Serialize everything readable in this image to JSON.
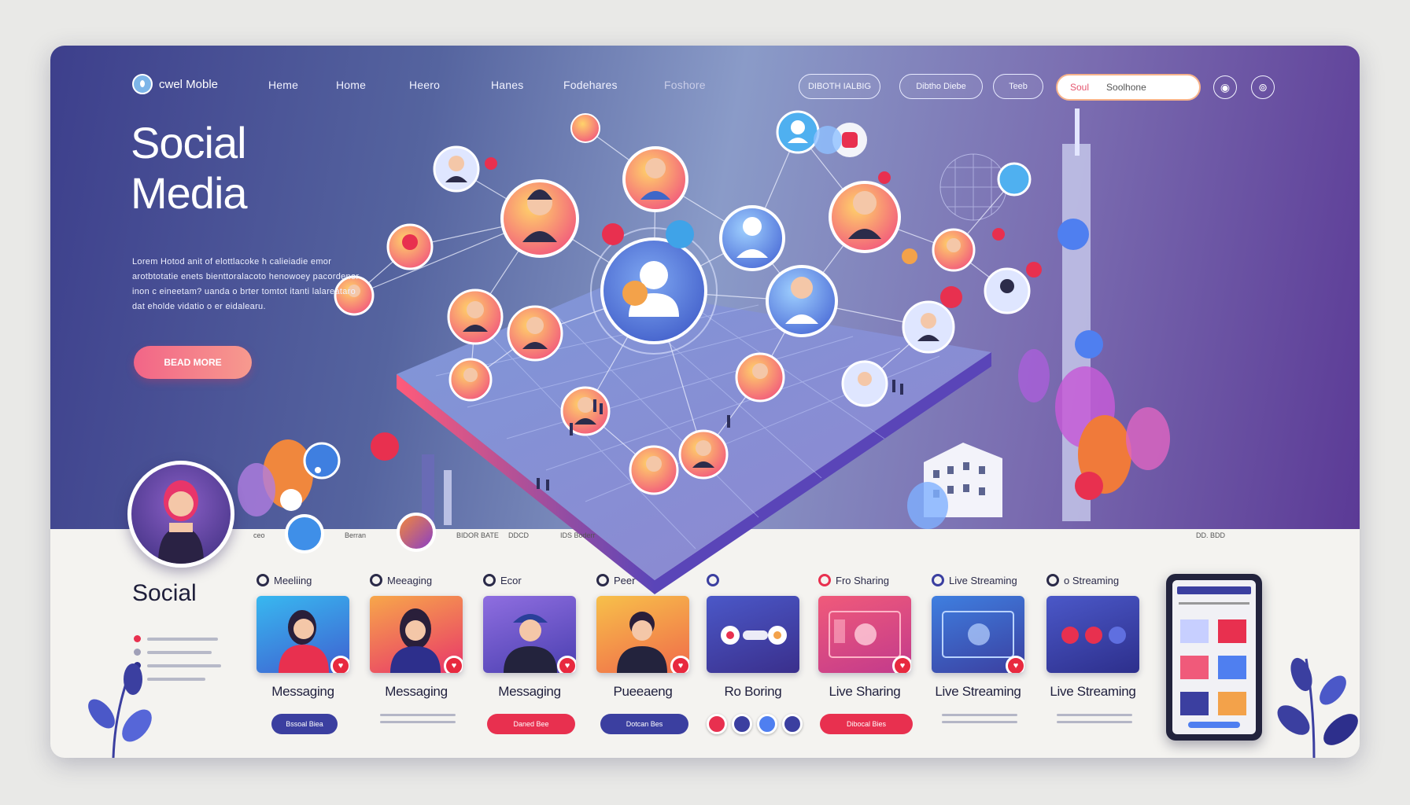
{
  "nav": {
    "logo_text": "cwel Moble",
    "links": [
      "Heme",
      "Home",
      "Heero",
      "Hanes",
      "Fodehares",
      "Foshore"
    ],
    "buttons": [
      "DIBOTH IALBIG",
      "Dibtho Diebe",
      "Teeb"
    ],
    "search": {
      "label": "Soul",
      "placeholder": "Soolhone"
    }
  },
  "hero": {
    "title_line1": "Social",
    "title_line2": "Media",
    "description": "Lorem Hotod anit of elottlacoke h calieiadie emor arotbtotatie enets bienttoralacoto henowoey pacordenor inon c eineetam? uanda o brter tomtot itanti lalareataro dat eholde vidatio o er eidalearu.",
    "cta": "BEAD MORE"
  },
  "subrow": [
    "ceo",
    "Berran",
    "BIDOR BATE",
    "DDCD",
    "IDS Boderr",
    "DD. BDD"
  ],
  "sidebar": {
    "title": "Social",
    "items": [
      {
        "color": "#e8304f",
        "width": 90
      },
      {
        "color": "#a0a0b8",
        "width": 82
      },
      {
        "color": "#2d2f8c",
        "width": 94
      },
      {
        "color": "#a0a0b8",
        "width": 74
      }
    ]
  },
  "cards": [
    {
      "tag": "Meeliing",
      "label": "Messaging",
      "button": "Bssoal Biea",
      "button_color": "#3b3fa0",
      "img": "person1"
    },
    {
      "tag": "Meeaging",
      "label": "Messaging",
      "button": "",
      "button_color": "",
      "img": "person2"
    },
    {
      "tag": "Ecor",
      "label": "Messaging",
      "button": "Daned Bee",
      "button_color": "#e8304f",
      "img": "person3"
    },
    {
      "tag": "Peer",
      "label": "Pueeaeng",
      "button": "Dotcan Bes",
      "button_color": "#3b3fa0",
      "img": "person4"
    },
    {
      "tag": "",
      "label": "Ro Boring",
      "button": "",
      "button_color": "",
      "img": "ui1"
    },
    {
      "tag": "Fro Sharing",
      "label": "Live Sharing",
      "button": "Dibocal Bies",
      "button_color": "#e8304f",
      "img": "ui2"
    },
    {
      "tag": "Live Streaming",
      "label": "Live Streaming",
      "button": "",
      "button_color": "",
      "img": "ui3"
    },
    {
      "tag": "o Streaming",
      "label": "Live Streaming",
      "button": "",
      "button_color": "",
      "img": "ui4"
    }
  ],
  "colors": {
    "accent_pink": "#f26587",
    "accent_red": "#e8293f",
    "navy": "#3b3fa0",
    "purple": "#5b3a96"
  }
}
